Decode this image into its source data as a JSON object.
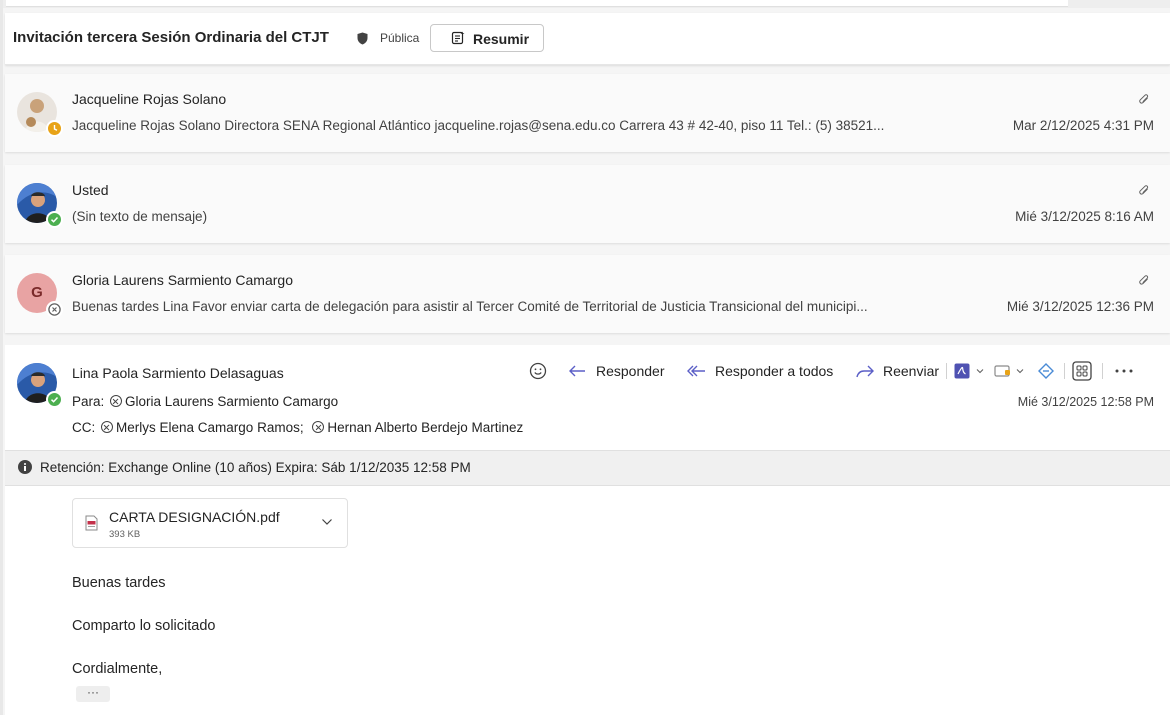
{
  "subject": {
    "title": "Invitación tercera Sesión Ordinaria del CTJT",
    "visibility": "Pública",
    "summarize_label": "Resumir"
  },
  "messages": [
    {
      "sender": "Jacqueline Rojas Solano",
      "preview": "Jacqueline Rojas Solano Directora SENA Regional Atlántico jacqueline.rojas@sena.edu.co Carrera 43 # 42-40, piso 11 Tel.: (5) 38521...",
      "date": "Mar 2/12/2025 4:31 PM",
      "presence": "away",
      "presence_color": "#e8a317"
    },
    {
      "sender": "Usted",
      "preview": "(Sin texto de mensaje)",
      "date": "Mié 3/12/2025 8:16 AM",
      "presence": "available",
      "presence_color": "#4caf50"
    },
    {
      "sender": "Gloria Laurens Sarmiento Camargo",
      "preview": "Buenas tardes Lina Favor enviar carta de delegación para asistir al Tercer Comité de Territorial de Justicia Transicional del municipi...",
      "date": "Mié 3/12/2025 12:36 PM",
      "avatar_initial": "G",
      "avatar_color": "#e8a3a3",
      "presence": "offline"
    }
  ],
  "open_message": {
    "sender": "Lina Paola Sarmiento Delasaguas",
    "to_label": "Para:",
    "to": "Gloria Laurens Sarmiento Camargo",
    "cc_label": "CC:",
    "cc": [
      "Merlys Elena Camargo Ramos;",
      "Hernan Alberto Berdejo Martinez"
    ],
    "date": "Mié 3/12/2025 12:58 PM",
    "actions": {
      "reply": "Responder",
      "reply_all": "Responder a todos",
      "forward": "Reenviar"
    },
    "retention": "Retención: Exchange Online (10 años) Expira: Sáb 1/12/2035 12:58 PM",
    "attachment": {
      "name": "CARTA DESIGNACIÓN.pdf",
      "size": "393 KB"
    },
    "body": [
      "Buenas tardes",
      "Comparto lo solicitado",
      "Cordialmente,"
    ],
    "more": "···"
  },
  "colors": {
    "accent": "#5b5fc7",
    "pdf_red": "#c4314b"
  }
}
